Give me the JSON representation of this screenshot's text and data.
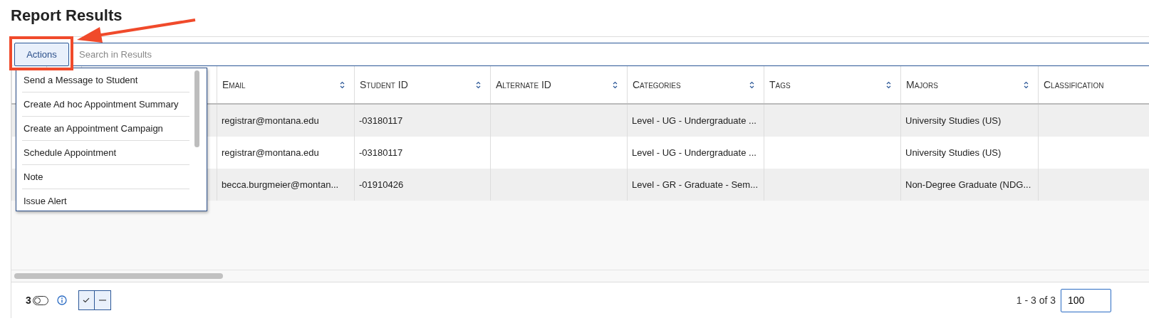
{
  "title": "Report Results",
  "toolbar": {
    "actions_button": "Actions",
    "search": {
      "placeholder": "Search in Results"
    }
  },
  "actions_menu": [
    {
      "label": "Send a Message to Student"
    },
    {
      "label": "Create Ad hoc Appointment Summary"
    },
    {
      "label": "Create an Appointment Campaign"
    },
    {
      "label": "Schedule Appointment"
    },
    {
      "label": "Note"
    },
    {
      "label": "Issue Alert"
    }
  ],
  "table": {
    "columns": [
      {
        "label": "Email",
        "sortable": true
      },
      {
        "label": "Student ID",
        "sortable": true
      },
      {
        "label": "Alternate ID",
        "sortable": true
      },
      {
        "label": "Categories",
        "sortable": true
      },
      {
        "label": "Tags",
        "sortable": true
      },
      {
        "label": "Majors",
        "sortable": true
      },
      {
        "label": "Classification",
        "sortable": false
      }
    ],
    "rows": [
      [
        "registrar@montana.edu",
        "-03180117",
        "",
        "Level - UG - Undergraduate ...",
        "",
        "University Studies (US)",
        ""
      ],
      [
        "registrar@montana.edu",
        "-03180117",
        "",
        "Level - UG - Undergraduate ...",
        "",
        "University Studies (US)",
        ""
      ],
      [
        "becca.burgmeier@montan...",
        "-01910426",
        "",
        "Level - GR - Graduate - Sem...",
        "",
        "Non-Degree Graduate (NDG...",
        ""
      ]
    ]
  },
  "footer": {
    "selected_count": "3",
    "toggle_on": false,
    "pagination": "1 - 3 of 3",
    "page_size": "100"
  }
}
